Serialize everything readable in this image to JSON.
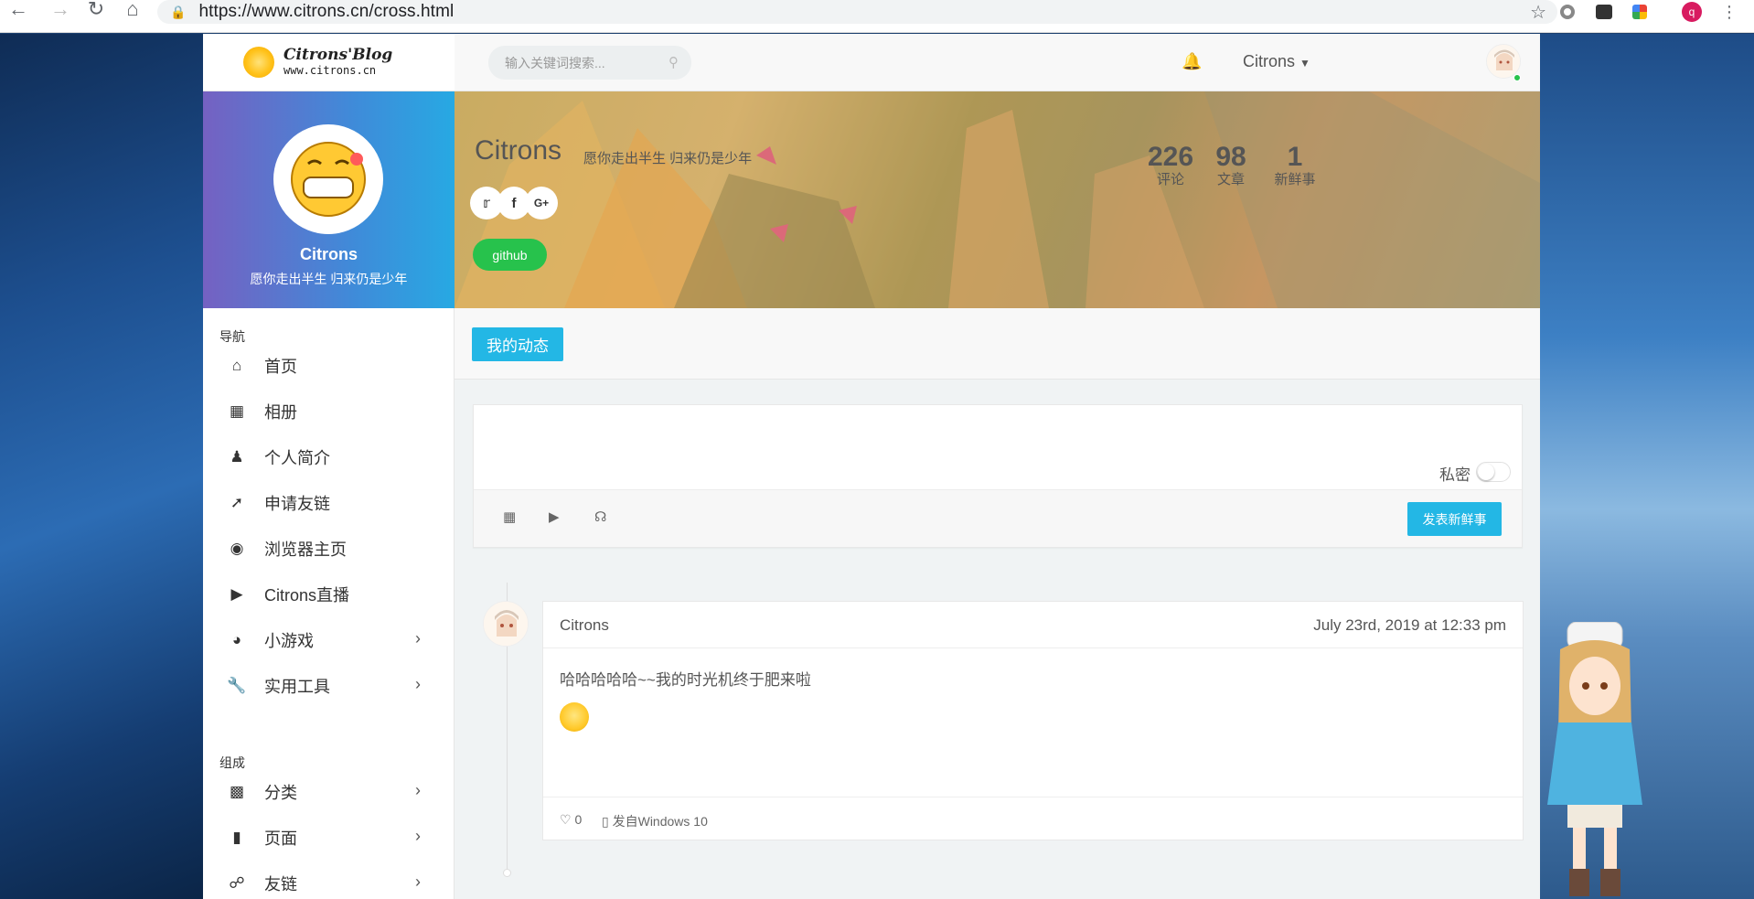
{
  "browser": {
    "url": "https://www.citrons.cn/cross.html",
    "profile_initial": "q"
  },
  "site": {
    "logo_title": "Citrons'Blog",
    "logo_subtitle": "www.citrons.cn",
    "search_placeholder": "输入关键词搜索...",
    "user_menu": "Citrons"
  },
  "profile": {
    "name": "Citrons",
    "motto": "愿你走出半生 归来仍是少年",
    "github_label": "github",
    "stats": [
      {
        "value": "226",
        "label": "评论"
      },
      {
        "value": "98",
        "label": "文章"
      },
      {
        "value": "1",
        "label": "新鲜事"
      }
    ]
  },
  "sidebar": {
    "nav_title": "导航",
    "items": [
      {
        "label": "首页",
        "icon": "home-icon"
      },
      {
        "label": "相册",
        "icon": "image-icon"
      },
      {
        "label": "个人简介",
        "icon": "user-icon"
      },
      {
        "label": "申请友链",
        "icon": "pin-icon"
      },
      {
        "label": "浏览器主页",
        "icon": "globe-icon"
      },
      {
        "label": "Citrons直播",
        "icon": "live-icon"
      },
      {
        "label": "小游戏",
        "icon": "game-icon"
      },
      {
        "label": "实用工具",
        "icon": "wrench-icon"
      }
    ],
    "compose_title": "组成",
    "items2": [
      {
        "label": "分类",
        "icon": "grid-icon"
      },
      {
        "label": "页面",
        "icon": "file-icon"
      },
      {
        "label": "友链",
        "icon": "link-icon"
      }
    ]
  },
  "tabs": {
    "active": "我的动态"
  },
  "composer": {
    "private_label": "私密",
    "post_button": "发表新鲜事"
  },
  "post": {
    "author": "Citrons",
    "date": "July 23rd, 2019 at 12:33 pm",
    "text": "哈哈哈哈哈~~我的时光机终于肥来啦",
    "likes": "0",
    "device": "发自Windows 10"
  }
}
